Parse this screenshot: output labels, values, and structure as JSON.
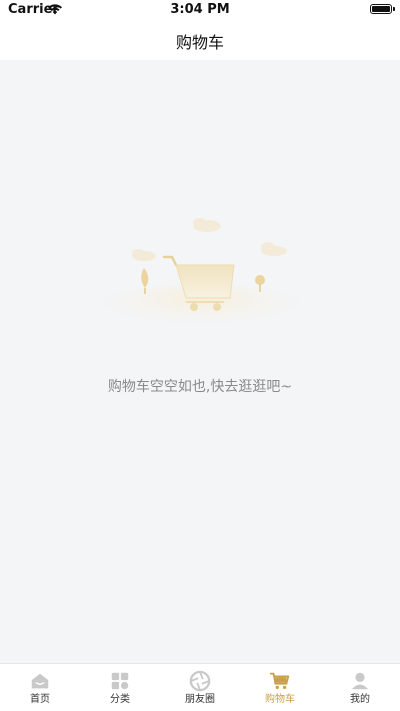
{
  "status_bar": {
    "carrier": "Carrier",
    "time": "3:04 PM"
  },
  "nav": {
    "title": "购物车"
  },
  "empty_state": {
    "message": "购物车空空如也,快去逛逛吧~"
  },
  "tab_bar": {
    "items": [
      {
        "label": "首页",
        "icon": "home-icon",
        "active": false
      },
      {
        "label": "分类",
        "icon": "grid-icon",
        "active": false
      },
      {
        "label": "朋友圈",
        "icon": "aperture-icon",
        "active": false
      },
      {
        "label": "购物车",
        "icon": "cart-icon",
        "active": true
      },
      {
        "label": "我的",
        "icon": "user-icon",
        "active": false
      }
    ]
  },
  "colors": {
    "accent": "#c8a14a",
    "inactive_icon": "#bdbdbd",
    "background": "#f4f5f7"
  }
}
